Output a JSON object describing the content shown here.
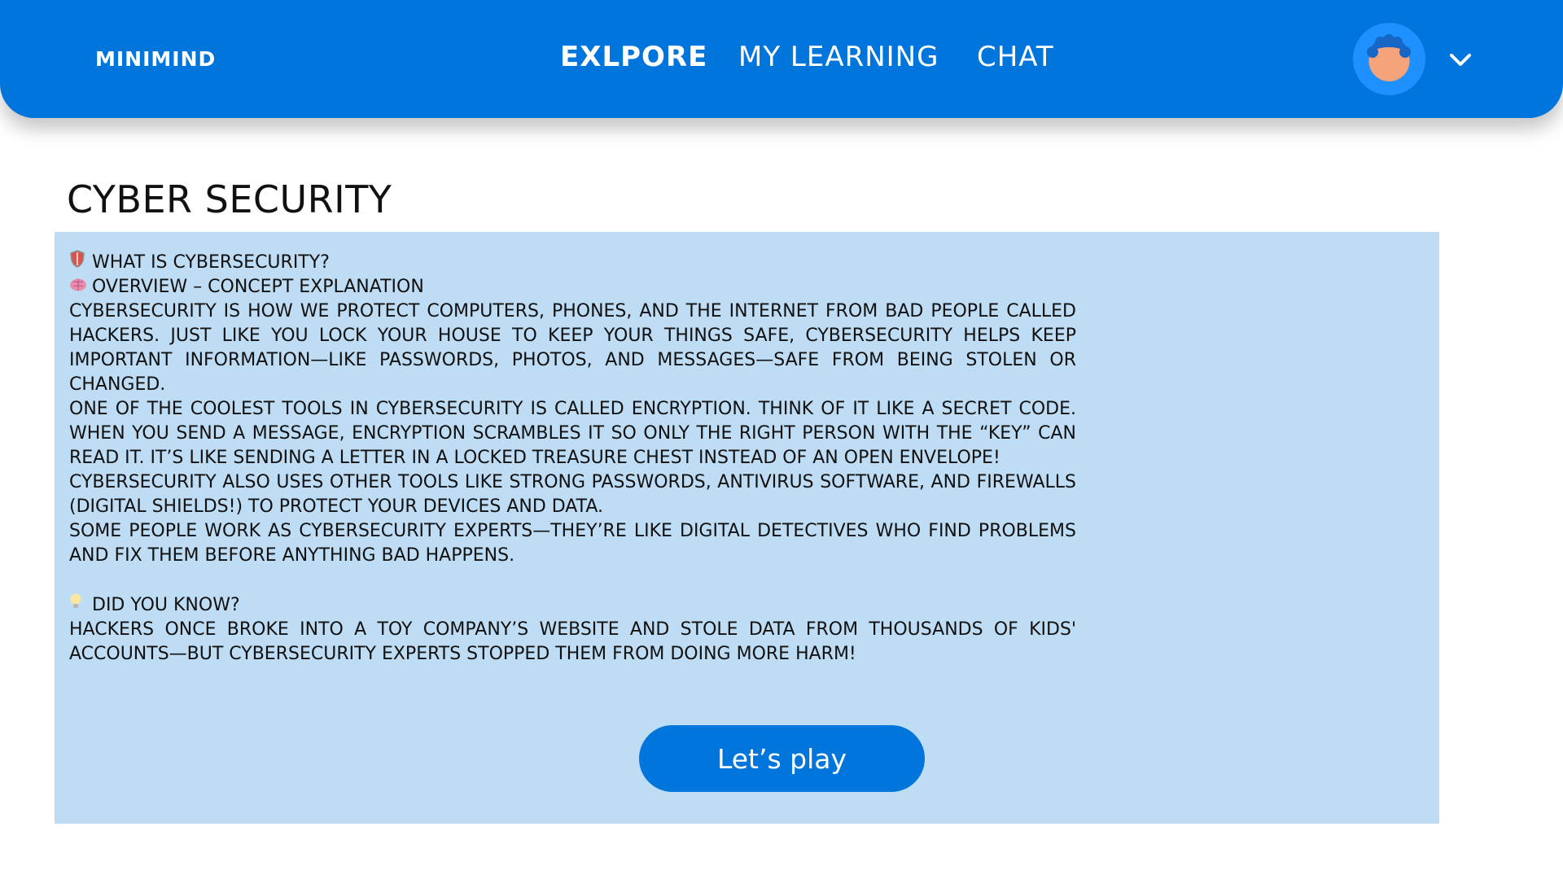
{
  "header": {
    "logo": "MINIMIND",
    "nav": [
      {
        "label": "EXLPORE",
        "active": true
      },
      {
        "label": "MY LEARNING",
        "active": false
      },
      {
        "label": "CHAT",
        "active": false
      }
    ],
    "avatar_icon": "user-avatar-icon",
    "menu_icon": "chevron-down-icon"
  },
  "page": {
    "title": "CYBER SECURITY"
  },
  "article": {
    "heading1": {
      "icon": "shield-icon",
      "text": "WHAT IS CYBERSECURITY?"
    },
    "heading2": {
      "icon": "brain-icon",
      "text": "OVERVIEW – CONCEPT EXPLANATION"
    },
    "paragraphs": [
      "CYBERSECURITY IS HOW WE PROTECT COMPUTERS, PHONES, AND THE INTERNET FROM BAD PEOPLE CALLED HACKERS. JUST LIKE YOU LOCK YOUR HOUSE TO KEEP YOUR THINGS SAFE, CYBERSECURITY HELPS KEEP IMPORTANT INFORMATION—LIKE PASSWORDS, PHOTOS, AND MESSAGES—SAFE FROM BEING STOLEN OR CHANGED.",
      "ONE OF THE COOLEST TOOLS IN CYBERSECURITY IS CALLED ENCRYPTION. THINK OF IT LIKE A SECRET CODE. WHEN YOU SEND A MESSAGE, ENCRYPTION SCRAMBLES IT SO ONLY THE RIGHT PERSON WITH THE “KEY” CAN READ IT. IT’S LIKE SENDING A LETTER IN A LOCKED TREASURE CHEST INSTEAD OF AN OPEN ENVELOPE!",
      "CYBERSECURITY ALSO USES OTHER TOOLS LIKE STRONG PASSWORDS, ANTIVIRUS SOFTWARE, AND FIREWALLS (DIGITAL SHIELDS!) TO PROTECT YOUR DEVICES AND DATA.",
      "SOME PEOPLE WORK AS CYBERSECURITY EXPERTS—THEY’RE LIKE DIGITAL DETECTIVES WHO FIND PROBLEMS AND FIX THEM BEFORE ANYTHING BAD HAPPENS."
    ],
    "fact_heading": {
      "icon": "lightbulb-icon",
      "text": "DID YOU KNOW?"
    },
    "fact_text": "HACKERS ONCE BROKE INTO A TOY COMPANY’S WEBSITE AND STOLE DATA FROM THOUSANDS OF KIDS' ACCOUNTS—BUT CYBERSECURITY EXPERTS STOPPED THEM FROM DOING MORE HARM!"
  },
  "actions": {
    "play_label": "Let’s play"
  },
  "colors": {
    "brand_blue": "#0075DB",
    "card_background": "#BEDCF4",
    "avatar_face": "#F4A37A"
  }
}
